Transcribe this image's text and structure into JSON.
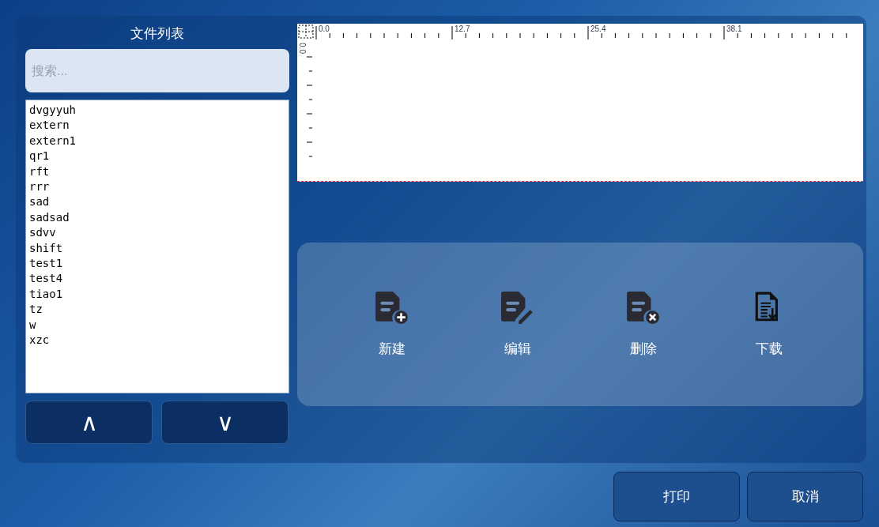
{
  "file_panel": {
    "title": "文件列表",
    "search": {
      "placeholder": "搜索..."
    },
    "files": [
      "dvgyyuh",
      "extern",
      "extern1",
      "qr1",
      "rft",
      "rrr",
      "sad",
      "sadsad",
      "sdvv",
      "shift",
      "test1",
      "test4",
      "tiao1",
      "tz",
      "w",
      "xzc"
    ],
    "scroll_buttons": [
      "∧",
      "∨"
    ]
  },
  "preview": {
    "ruler_top_labels": [
      "0.0",
      "12.7",
      "25.4",
      "38.1"
    ],
    "ruler_left_label": "0.0"
  },
  "actions": [
    {
      "kind": "new",
      "label": "新建"
    },
    {
      "kind": "edit",
      "label": "编辑"
    },
    {
      "kind": "delete",
      "label": "删除"
    },
    {
      "kind": "download",
      "label": "下载"
    }
  ],
  "footer_buttons": [
    "打印",
    "取消"
  ]
}
